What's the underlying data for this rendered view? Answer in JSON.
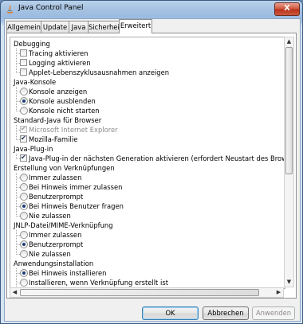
{
  "window": {
    "title": "Java Control Panel",
    "close_label": "X"
  },
  "tabs": [
    {
      "label": "Allgemein"
    },
    {
      "label": "Update"
    },
    {
      "label": "Java"
    },
    {
      "label": "Sicherheit"
    },
    {
      "label": "Erweitert",
      "active": true
    }
  ],
  "tree": {
    "debugging": {
      "label": "Debugging",
      "items": [
        {
          "label": "Tracing aktivieren",
          "checked": false
        },
        {
          "label": "Logging aktivieren",
          "checked": false
        },
        {
          "label": "Applet-Lebenszyklusausnahmen anzeigen",
          "checked": false
        }
      ]
    },
    "konsole": {
      "label": "Java-Konsole",
      "items": [
        {
          "label": "Konsole anzeigen",
          "selected": false
        },
        {
          "label": "Konsole ausblenden",
          "selected": true
        },
        {
          "label": "Konsole nicht starten",
          "selected": false
        }
      ]
    },
    "browser": {
      "label": "Standard-Java für Browser",
      "items": [
        {
          "label": "Microsoft Internet Explorer",
          "checked": true,
          "disabled": true
        },
        {
          "label": "Mozilla-Familie",
          "checked": true
        }
      ]
    },
    "plugin": {
      "label": "Java-Plug-in",
      "items": [
        {
          "label": "Java-Plug-in der nächsten Generation aktivieren (erfordert Neustart des Browsers)",
          "checked": true
        }
      ]
    },
    "verknuepfungen": {
      "label": "Erstellung von Verknüpfungen",
      "items": [
        {
          "label": "Immer zulassen",
          "selected": false
        },
        {
          "label": "Bei Hinweis immer zulassen",
          "selected": false
        },
        {
          "label": "Benutzerprompt",
          "selected": false
        },
        {
          "label": "Bei Hinweis Benutzer fragen",
          "selected": true
        },
        {
          "label": "Nie zulassen",
          "selected": false
        }
      ]
    },
    "jnlp": {
      "label": "JNLP-Datei/MIME-Verknüpfung",
      "items": [
        {
          "label": "Immer zulassen",
          "selected": false
        },
        {
          "label": "Benutzerprompt",
          "selected": true
        },
        {
          "label": "Nie zulassen",
          "selected": false
        }
      ]
    },
    "installation": {
      "label": "Anwendungsinstallation",
      "items": [
        {
          "label": "Bei Hinweis installieren",
          "selected": true
        },
        {
          "label": "Installieren, wenn Verknüpfung erstellt ist",
          "selected": false
        }
      ]
    }
  },
  "buttons": {
    "ok": "OK",
    "cancel": "Abbrechen",
    "apply": "Anwenden"
  },
  "colors": {
    "selected_radio": "#1e3f78",
    "title_gradient": "#a7c3e2"
  }
}
